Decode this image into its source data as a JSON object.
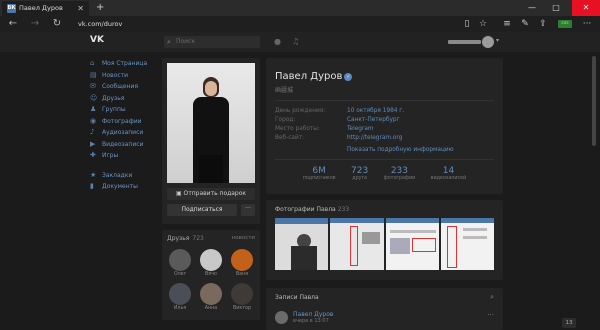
{
  "browser": {
    "tab_title": "Павел Дуров",
    "favicon": "ВК",
    "tab_close": "✕",
    "new_tab": "+",
    "address": "vk.com/durov",
    "controls": {
      "minimize": "—",
      "maximize": "□",
      "close": "✕"
    },
    "ext_label": "css"
  },
  "vk": {
    "logo": "VK",
    "search_placeholder": "Поиск"
  },
  "nav": {
    "items": [
      {
        "label": "Моя Страница",
        "icon": "home-icon"
      },
      {
        "label": "Новости",
        "icon": "news-icon"
      },
      {
        "label": "Сообщения",
        "icon": "messages-icon"
      },
      {
        "label": "Друзья",
        "icon": "friends-icon"
      },
      {
        "label": "Группы",
        "icon": "groups-icon"
      },
      {
        "label": "Фотографии",
        "icon": "camera-icon"
      },
      {
        "label": "Аудиозаписи",
        "icon": "music-icon"
      },
      {
        "label": "Видеозаписи",
        "icon": "video-icon"
      },
      {
        "label": "Игры",
        "icon": "gamepad-icon"
      }
    ],
    "secondary": [
      {
        "label": "Закладки",
        "icon": "star-icon"
      },
      {
        "label": "Документы",
        "icon": "document-icon"
      }
    ]
  },
  "profile": {
    "name": "Павел Дуров",
    "status": "画疆城",
    "gift_button": "Отправить подарок",
    "subscribe_button": "Подписаться",
    "more_button": "···",
    "info": [
      {
        "label": "День рождения:",
        "value": "10 октября 1984 г."
      },
      {
        "label": "Город:",
        "value": "Санкт-Петербург"
      },
      {
        "label": "Место работы:",
        "value": "Telegram"
      },
      {
        "label": "Веб-сайт:",
        "value": "http://telegram.org"
      }
    ],
    "show_more": "Показать подробную информацию",
    "stats": [
      {
        "value": "6M",
        "label": "подписчиков"
      },
      {
        "value": "723",
        "label": "друга"
      },
      {
        "value": "233",
        "label": "фотографии"
      },
      {
        "value": "14",
        "label": "видеозаписей"
      }
    ]
  },
  "friends": {
    "title": "Друзья",
    "count": "723",
    "updates": "новости",
    "rows": [
      [
        {
          "name": "Олег",
          "color": "#5a5a5a"
        },
        {
          "name": "Вячо",
          "color": "#c8c8c8"
        },
        {
          "name": "Ваня",
          "color": "#c2621a"
        }
      ],
      [
        {
          "name": "Илья",
          "color": "#4a4f57"
        },
        {
          "name": "Анна",
          "color": "#7a6a5e"
        },
        {
          "name": "Виктор",
          "color": "#3f3a36"
        }
      ]
    ]
  },
  "photos": {
    "title": "Фотографии Павла",
    "count": "233"
  },
  "posts": {
    "title": "Записи Павла",
    "author": "Павел Дуров",
    "time": "вчера в 13:07",
    "more": "···"
  },
  "chat_badge": "13"
}
